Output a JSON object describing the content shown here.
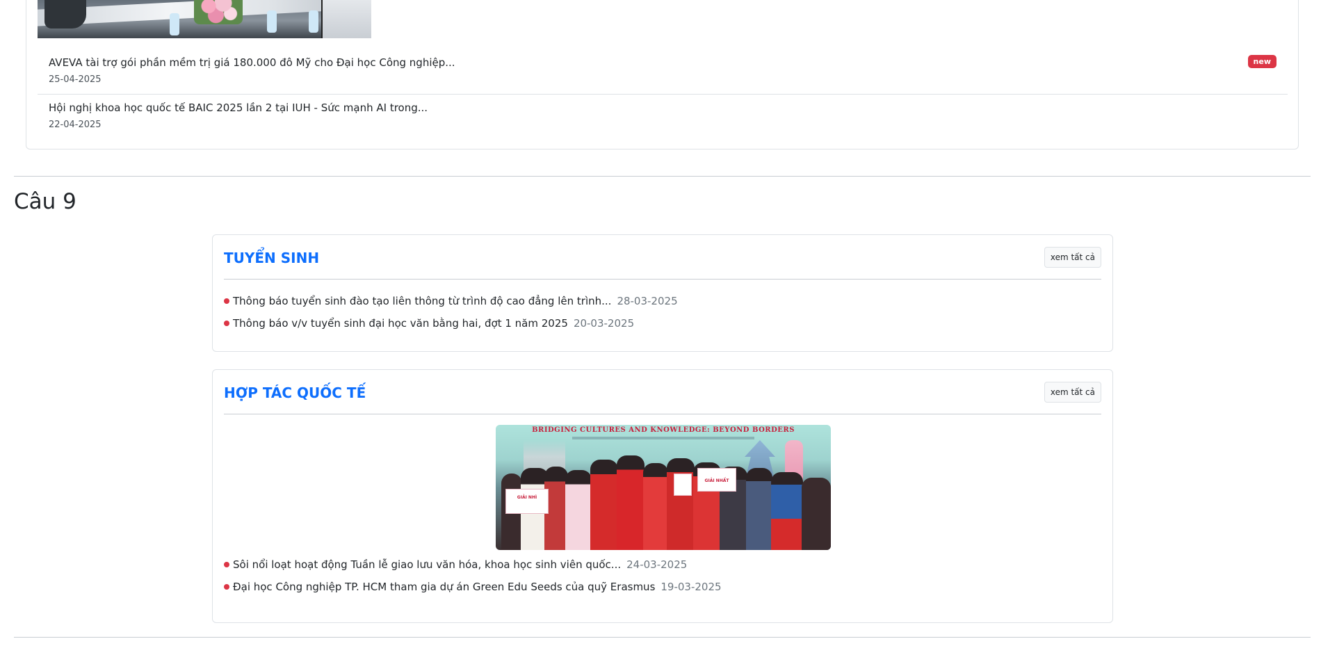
{
  "news": {
    "items": [
      {
        "title": "AVEVA tài trợ gói phần mềm trị giá 180.000 đô Mỹ cho Đại học Công nghiệp...",
        "date": "25-04-2025",
        "badge": "new"
      },
      {
        "title": "Hội nghị khoa học quốc tế BAIC 2025 lần 2 tại IUH - Sức mạnh AI trong...",
        "date": "22-04-2025"
      }
    ]
  },
  "section": {
    "heading": "Câu 9"
  },
  "categories": [
    {
      "title": "TUYỂN SINH",
      "see_all": "xem tất cả",
      "items": [
        {
          "title": "Thông báo tuyển sinh đào tạo liên thông từ trình độ cao đẳng lên trình...",
          "date": "28-03-2025"
        },
        {
          "title": "Thông báo v/v tuyển sinh đại học văn bằng hai, đợt 1 năm 2025",
          "date": "20-03-2025"
        }
      ]
    },
    {
      "title": "HỢP TÁC QUỐC TẾ",
      "see_all": "xem tất cả",
      "feature_image": {
        "banner_text": "BRIDGING CULTURES AND KNOWLEDGE: BEYOND BORDERS",
        "sign_left": "GIẢI NHÌ",
        "sign_right": "GIẢI NHẤT"
      },
      "items": [
        {
          "title": "Sôi nổi loạt hoạt động Tuần lễ giao lưu văn hóa, khoa học sinh viên quốc...",
          "date": "24-03-2025"
        },
        {
          "title": "Đại học Công nghiệp TP. HCM tham gia dự án Green Edu Seeds của quỹ Erasmus",
          "date": "19-03-2025"
        }
      ]
    }
  ],
  "colors": {
    "accent": "#0d6efd",
    "badge": "#dc3545",
    "bullet": "#dc3545",
    "border": "#dee2e6"
  }
}
